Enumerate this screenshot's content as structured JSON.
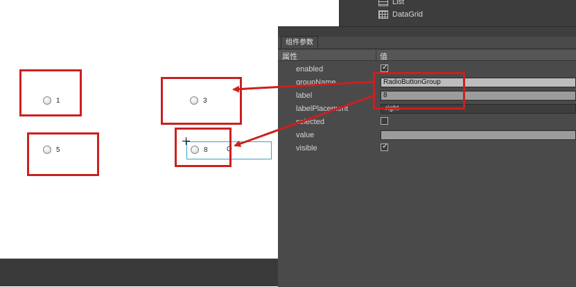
{
  "stage": {
    "radios": [
      {
        "label": "1"
      },
      {
        "label": "3"
      },
      {
        "label": "5"
      },
      {
        "label": "8"
      }
    ],
    "stray_text": "O"
  },
  "components_panel": {
    "items": [
      {
        "label": "List",
        "icon": "list-icon"
      },
      {
        "label": "DataGrid",
        "icon": "datagrid-icon"
      }
    ]
  },
  "params_panel": {
    "tab_label": "组件参数",
    "header": {
      "property": "属性",
      "value": "值"
    },
    "rows": [
      {
        "name": "enabled",
        "type": "checkbox",
        "checked": true
      },
      {
        "name": "groupName",
        "type": "text",
        "value": "RadioButtonGroup"
      },
      {
        "name": "label",
        "type": "text",
        "value": "8"
      },
      {
        "name": "labelPlacement",
        "type": "select",
        "value": "right"
      },
      {
        "name": "selected",
        "type": "checkbox",
        "checked": false
      },
      {
        "name": "value",
        "type": "text",
        "value": ""
      },
      {
        "name": "visible",
        "type": "checkbox",
        "checked": true
      }
    ]
  },
  "colors": {
    "annotation_red": "#cc1f1f",
    "selection_blue": "#3aa0c8",
    "panel_bg": "#4a4a4a"
  }
}
